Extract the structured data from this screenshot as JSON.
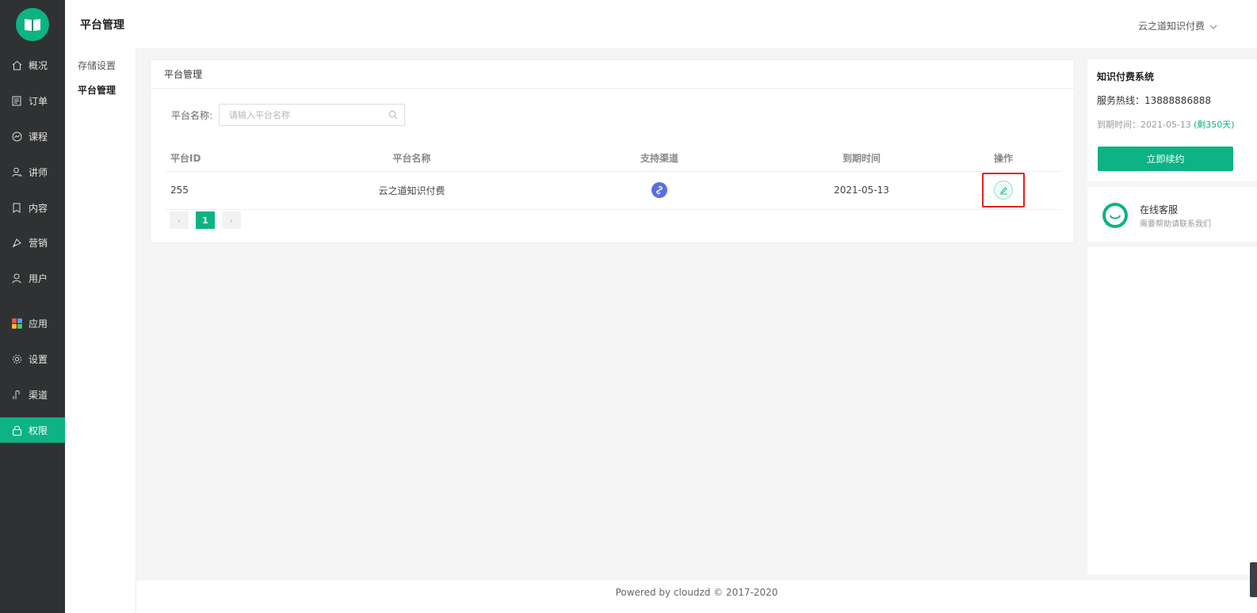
{
  "sidebar": {
    "logo_icon": "book-icon",
    "items": [
      {
        "label": "概况",
        "icon": "home-icon"
      },
      {
        "label": "订单",
        "icon": "order-icon"
      },
      {
        "label": "课程",
        "icon": "course-icon"
      },
      {
        "label": "讲师",
        "icon": "teacher-icon"
      },
      {
        "label": "内容",
        "icon": "content-icon"
      },
      {
        "label": "营销",
        "icon": "marketing-icon"
      },
      {
        "label": "用户",
        "icon": "user-icon"
      },
      {
        "label": "应用",
        "icon": "apps-icon"
      },
      {
        "label": "设置",
        "icon": "gear-icon"
      },
      {
        "label": "渠道",
        "icon": "channel-icon"
      },
      {
        "label": "权限",
        "icon": "lock-icon"
      }
    ],
    "active": "权限"
  },
  "header": {
    "title": "平台管理",
    "account": "云之道知识付费"
  },
  "submenu": {
    "items": [
      "存储设置",
      "平台管理"
    ],
    "active": "平台管理"
  },
  "card": {
    "title": "平台管理",
    "filter_label": "平台名称:",
    "search_placeholder": "请输入平台名称",
    "columns": [
      "平台ID",
      "平台名称",
      "支持渠道",
      "到期时间",
      "操作"
    ],
    "rows": [
      {
        "id": "255",
        "name": "云之道知识付费",
        "channel_icon": "link-icon",
        "expire": "2021-05-13",
        "action_icon": "edit-icon"
      }
    ],
    "pagination": {
      "prev": "‹",
      "current": "1",
      "next": "›"
    }
  },
  "right_panel": {
    "system_title": "知识付费系统",
    "hotline": "服务热线：13888886888",
    "expire": "到期时间：2021-05-13",
    "remaining": "(剩350天)",
    "renew_button": "立即续约",
    "cs_title": "在线客服",
    "cs_subtitle": "需要帮助请联系我们"
  },
  "footer": {
    "text": "Powered by cloudzd © 2017-2020"
  },
  "colors": {
    "accent": "#0db383",
    "sidebar_bg": "#2f3132",
    "highlight_border": "#e0201e",
    "channel_icon": "#5b6ee0"
  }
}
